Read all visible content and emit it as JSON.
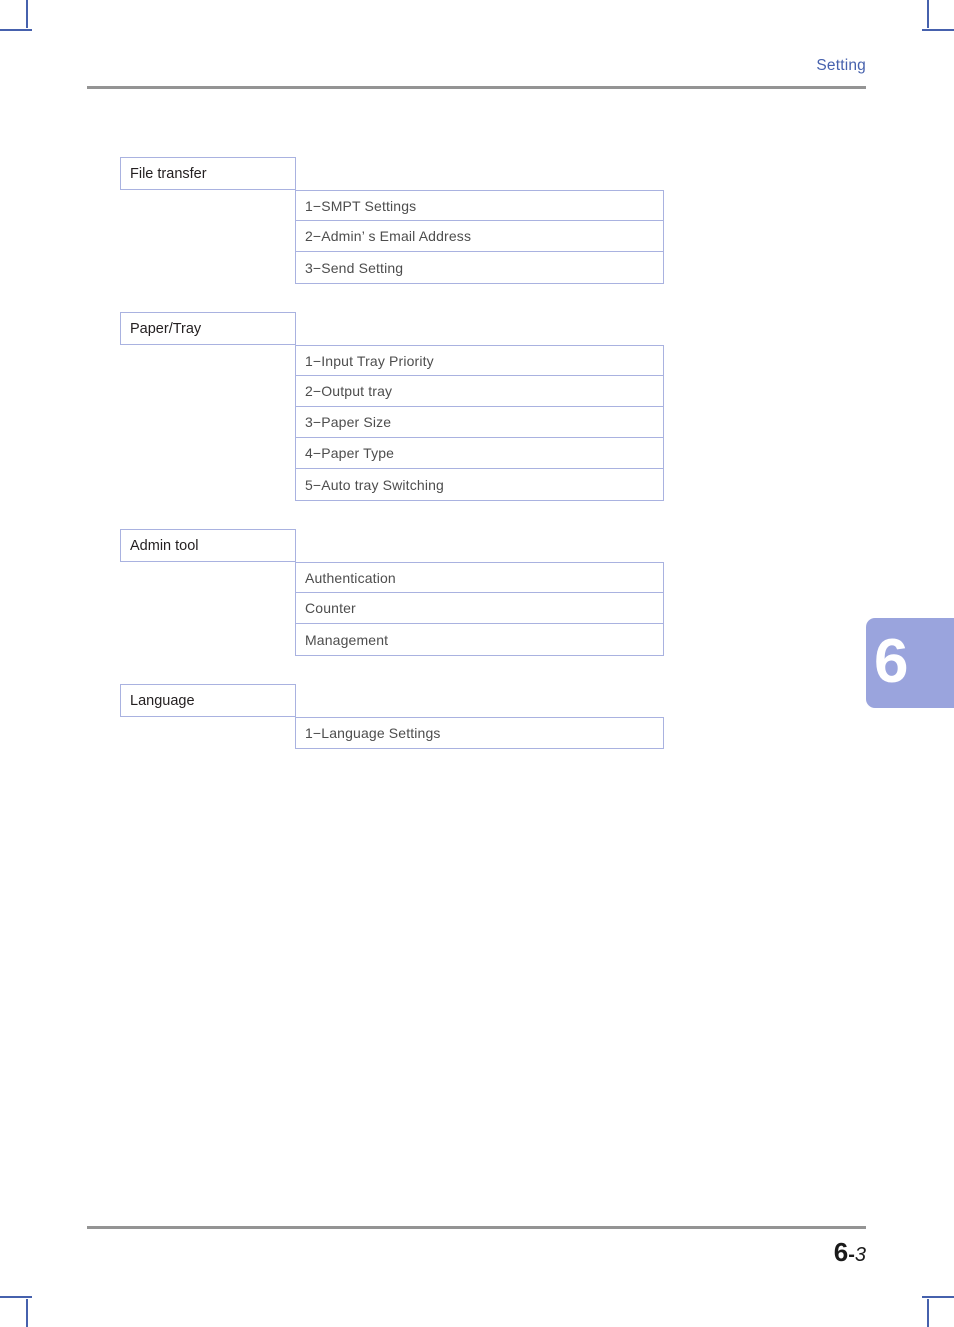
{
  "header": {
    "title": "Setting"
  },
  "chapter_tab": {
    "number": "6"
  },
  "menu": {
    "groups": [
      {
        "title": "File transfer",
        "rows": [
          "1−SMPT Settings",
          "2−Admin’ s Email Address",
          "3−Send Setting"
        ]
      },
      {
        "title": "Paper/Tray",
        "rows": [
          "1−Input Tray Priority",
          "2−Output tray",
          "3−Paper Size",
          "4−Paper Type",
          "5−Auto tray Switching"
        ]
      },
      {
        "title": "Admin tool",
        "rows": [
          "Authentication",
          "Counter",
          "Management"
        ]
      },
      {
        "title": "Language",
        "rows": [
          "1−Language Settings"
        ]
      }
    ]
  },
  "footer": {
    "page_chapter": "6",
    "page_separator": "-",
    "page_number": "3"
  },
  "colors": {
    "accent_blue": "#4661ad",
    "tab_periwinkle": "#9aa4dd",
    "table_border": "#a9b2e0",
    "rule_gray": "#949494",
    "crop_mark": "#4661ad"
  }
}
